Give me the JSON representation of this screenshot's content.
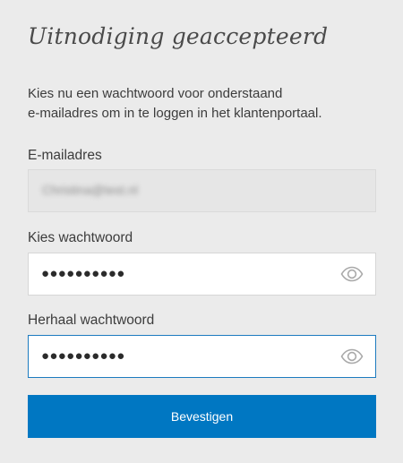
{
  "title": "Uitnodiging geaccepteerd",
  "intro": {
    "line1": "Kies nu een wachtwoord voor onderstaand",
    "line2": "e-mailadres om in te loggen in het klantenportaal."
  },
  "email": {
    "label": "E-mailadres",
    "value": "Christina@test.nl"
  },
  "password": {
    "label": "Kies wachtwoord",
    "value": "●●●●●●●●●●",
    "eye_icon": "eye-icon"
  },
  "confirm": {
    "label": "Herhaal wachtwoord",
    "value": "●●●●●●●●●●",
    "eye_icon": "eye-icon"
  },
  "submit": {
    "label": "Bevestigen"
  },
  "colors": {
    "background": "#ebebeb",
    "button": "#0077c2",
    "focus_border": "#1d7bbf"
  }
}
